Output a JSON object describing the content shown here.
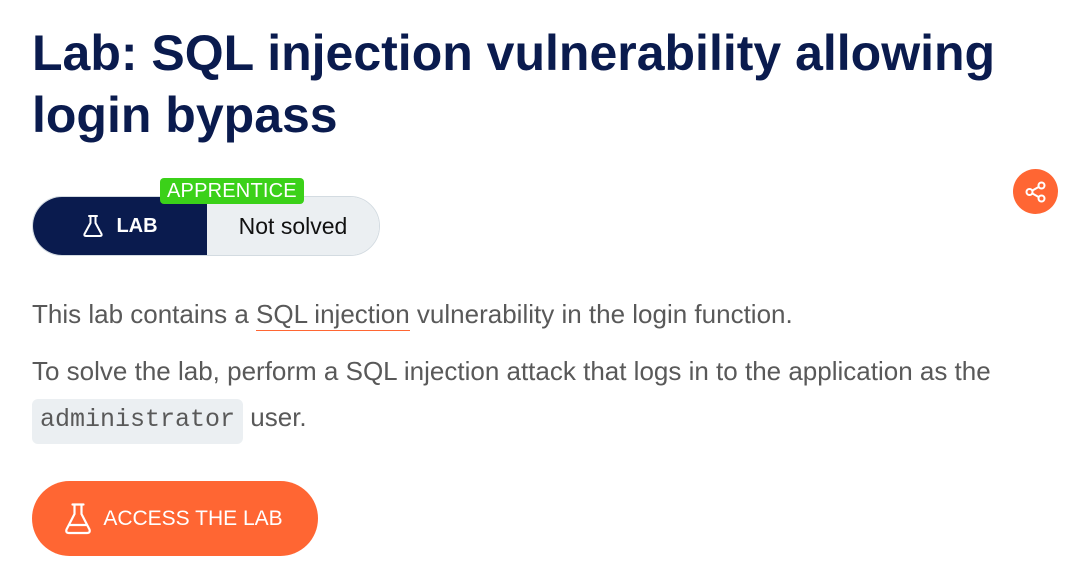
{
  "page": {
    "title": "Lab: SQL injection vulnerability allowing login bypass"
  },
  "badge": {
    "level": "APPRENTICE",
    "type": "LAB",
    "status": "Not solved"
  },
  "description": {
    "p1_before": "This lab contains a ",
    "p1_link": "SQL injection",
    "p1_after": " vulnerability in the login function.",
    "p2_before": "To solve the lab, perform a SQL injection attack that logs in to the application as the ",
    "p2_code": "administrator",
    "p2_after": " user."
  },
  "actions": {
    "access_label": "ACCESS THE LAB"
  },
  "icons": {
    "share": "share-icon",
    "flask": "flask-icon"
  },
  "colors": {
    "navy": "#0a1b4e",
    "orange": "#ff6633",
    "apprentice_green": "#3bd119",
    "status_bg": "#ebeff2",
    "body_text": "#595959"
  }
}
